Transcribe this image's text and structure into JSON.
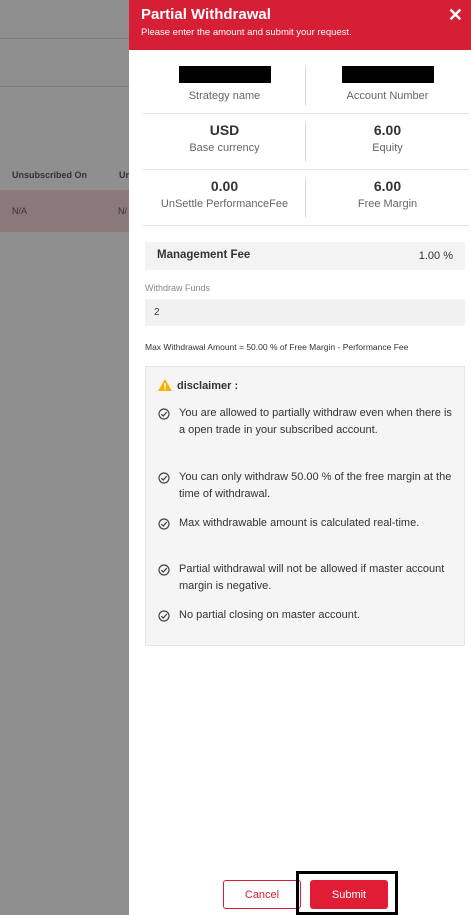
{
  "background": {
    "columns": [
      "Unsubscribed On",
      "Un"
    ],
    "row": [
      "N/A",
      "N/"
    ]
  },
  "header": {
    "title": "Partial Withdrawal",
    "subtitle": "Please enter the amount and submit your request.",
    "close_icon": "✕"
  },
  "info": {
    "strategy_label": "Strategy name",
    "account_label": "Account Number",
    "base_currency_value": "USD",
    "base_currency_label": "Base currency",
    "equity_value": "6.00",
    "equity_label": "Equity",
    "unsettle_value": "0.00",
    "unsettle_label": "UnSettle PerformanceFee",
    "free_margin_value": "6.00",
    "free_margin_label": "Free Margin"
  },
  "management_fee": {
    "label": "Management Fee",
    "value": "1.00 %"
  },
  "withdraw": {
    "label": "Withdraw Funds",
    "value": "2"
  },
  "max_note": "Max Withdrawal Amount = 50.00 % of Free Margin - Performance Fee",
  "disclaimer": {
    "title": "disclaimer :",
    "items": [
      "You are allowed to partially withdraw even when there is a open trade in your subscribed account.",
      "You can only withdraw 50.00 % of the free margin at the time of withdrawal.",
      "Max withdrawable amount is calculated real-time.",
      "Partial withdrawal will not be allowed if master account margin is negative.",
      "No partial closing on master account."
    ]
  },
  "buttons": {
    "cancel": "Cancel",
    "submit": "Submit"
  },
  "colors": {
    "accent": "#d61f35",
    "submit": "#e11d36"
  }
}
